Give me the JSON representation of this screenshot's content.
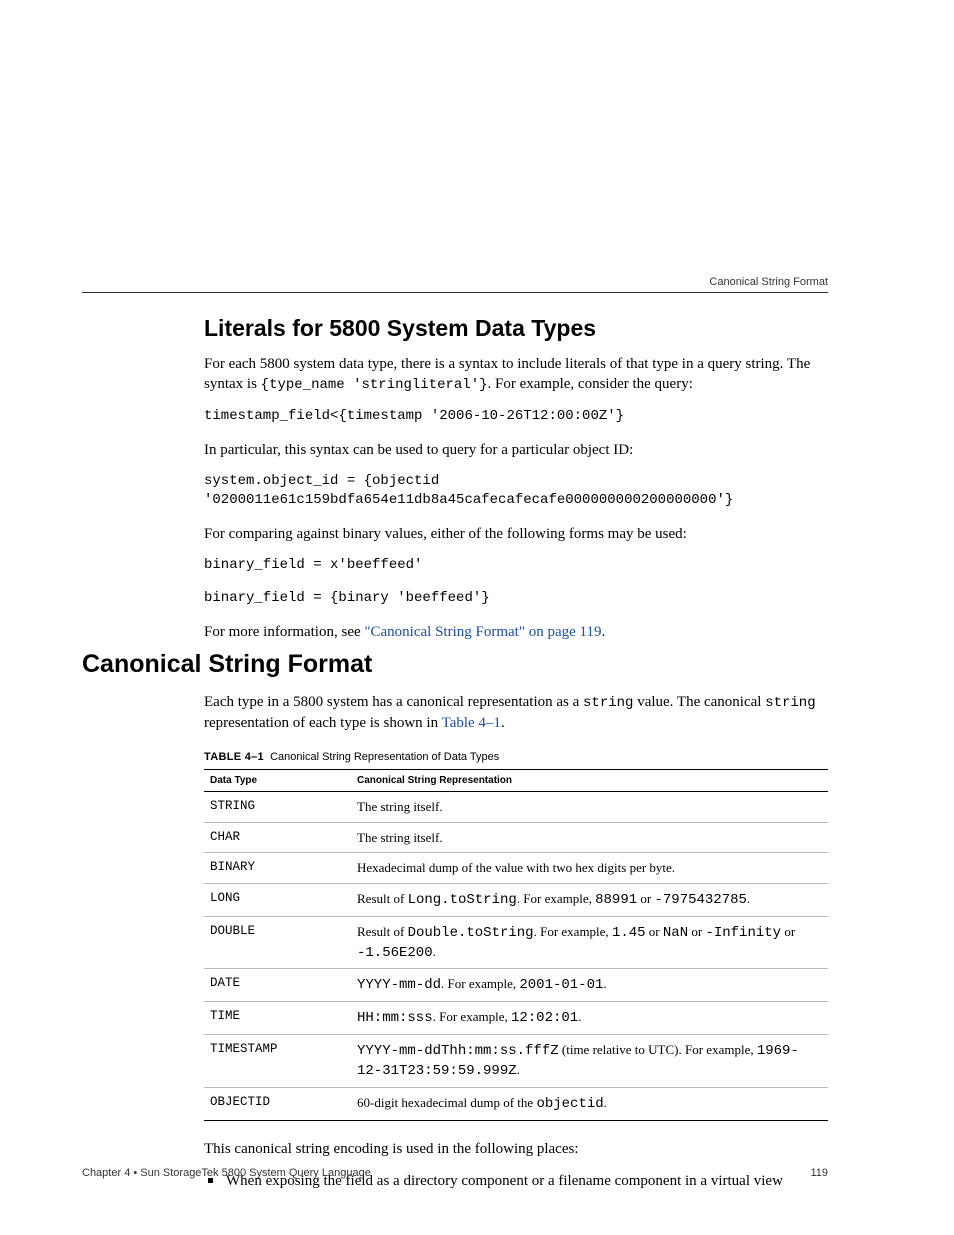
{
  "running_head": "Canonical String Format",
  "section1": {
    "title": "Literals for 5800 System Data Types",
    "p1_a": "For each 5800 system data type, there is a syntax to include literals of that type in a query string. The syntax is ",
    "p1_code": "{type_name 'stringliteral'}",
    "p1_b": ". For example, consider the query:",
    "code1": "timestamp_field<{timestamp '2006-10-26T12:00:00Z'}",
    "p2": "In particular, this syntax can be used to query for a particular object ID:",
    "code2": "system.object_id = {objectid\n'0200011e61c159bdfa654e11db8a45cafecafecafe000000000200000000'}",
    "p3": "For comparing against binary values, either of the following forms may be used:",
    "code3": "binary_field = x'beeffeed'",
    "code4": "binary_field = {binary 'beeffeed'}",
    "p4_a": "For more information, see ",
    "p4_link": "\"Canonical String Format\" on page 119",
    "p4_b": "."
  },
  "section2": {
    "title": "Canonical String Format",
    "p1_a": "Each type in a 5800 system has a canonical representation as a ",
    "p1_code1": "string",
    "p1_b": " value. The canonical ",
    "p1_code2": "string",
    "p1_c": " representation of each type is shown in ",
    "p1_link": "Table 4–1",
    "p1_d": "."
  },
  "table": {
    "label": "TABLE 4–1",
    "caption": "Canonical String Representation of Data Types",
    "headers": {
      "c1": "Data Type",
      "c2": "Canonical String Representation"
    },
    "rows": [
      {
        "dt": "STRING",
        "parts": [
          {
            "t": "The string itself."
          }
        ]
      },
      {
        "dt": "CHAR",
        "parts": [
          {
            "t": "The string itself."
          }
        ]
      },
      {
        "dt": "BINARY",
        "parts": [
          {
            "t": "Hexadecimal dump of the value with two hex digits per byte."
          }
        ]
      },
      {
        "dt": "LONG",
        "parts": [
          {
            "t": "Result of "
          },
          {
            "c": "Long.toString"
          },
          {
            "t": ". For example, "
          },
          {
            "c": "88991"
          },
          {
            "t": " or "
          },
          {
            "c": "-7975432785"
          },
          {
            "t": "."
          }
        ]
      },
      {
        "dt": "DOUBLE",
        "parts": [
          {
            "t": "Result of "
          },
          {
            "c": "Double.toString"
          },
          {
            "t": ". For example, "
          },
          {
            "c": "1.45"
          },
          {
            "t": " or "
          },
          {
            "c": "NaN"
          },
          {
            "t": " or "
          },
          {
            "c": "-Infinity"
          },
          {
            "t": " or "
          },
          {
            "c": "-1.56E200"
          },
          {
            "t": "."
          }
        ]
      },
      {
        "dt": "DATE",
        "parts": [
          {
            "c": "YYYY-mm-dd"
          },
          {
            "t": ". For example, "
          },
          {
            "c": "2001-01-01"
          },
          {
            "t": "."
          }
        ]
      },
      {
        "dt": "TIME",
        "parts": [
          {
            "c": "HH:mm:sss"
          },
          {
            "t": ". For example, "
          },
          {
            "c": "12:02:01"
          },
          {
            "t": "."
          }
        ]
      },
      {
        "dt": "TIMESTAMP",
        "parts": [
          {
            "c": "YYYY-mm-ddThh:mm:ss.fffZ"
          },
          {
            "t": " (time relative to UTC). For example, "
          },
          {
            "c": "1969-12-31T23:59:59.999Z"
          },
          {
            "t": "."
          }
        ]
      },
      {
        "dt": "OBJECTID",
        "parts": [
          {
            "t": "60-digit hexadecimal dump of the "
          },
          {
            "c": "objectid"
          },
          {
            "t": "."
          }
        ]
      }
    ]
  },
  "after_table": {
    "p": "This canonical string encoding is used in the following places:",
    "li1": "When exposing the field as a directory component or a filename component in a virtual view"
  },
  "footer": {
    "left": "Chapter 4 • Sun StorageTek 5800 System Query Language",
    "right": "119"
  }
}
